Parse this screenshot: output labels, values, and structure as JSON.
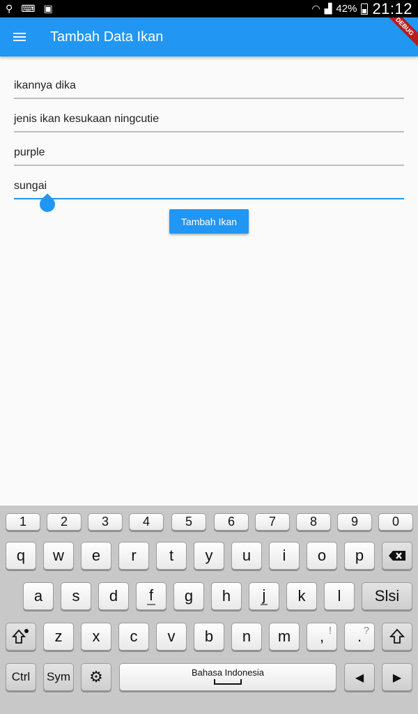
{
  "status_bar": {
    "icons_left": [
      "usb-icon",
      "keyboard-icon",
      "screenshot-icon"
    ],
    "battery_percent": "42%",
    "time": "21:12"
  },
  "app_bar": {
    "title": "Tambah Data Ikan",
    "color": "#2196f3",
    "debug_banner": "DEBUG"
  },
  "form": {
    "fields": [
      {
        "value": "ikannya dika"
      },
      {
        "value": "jenis ikan kesukaan ningcutie"
      },
      {
        "value": "purple"
      },
      {
        "value": "sungai"
      }
    ],
    "submit_label": "Tambah Ikan"
  },
  "keyboard": {
    "numbers": [
      "1",
      "2",
      "3",
      "4",
      "5",
      "6",
      "7",
      "8",
      "9",
      "0"
    ],
    "row1": [
      "q",
      "w",
      "e",
      "r",
      "t",
      "y",
      "u",
      "i",
      "o",
      "p"
    ],
    "row2": [
      "a",
      "s",
      "d",
      "f",
      "g",
      "h",
      "j",
      "k",
      "l"
    ],
    "row3": [
      "z",
      "x",
      "c",
      "v",
      "b",
      "n",
      "m"
    ],
    "comma": ",",
    "comma_hint": "!",
    "period": ".",
    "period_hint": "?",
    "enter_label": "Slsi",
    "ctrl_label": "Ctrl",
    "sym_label": "Sym",
    "space_label": "Bahasa Indonesia"
  }
}
